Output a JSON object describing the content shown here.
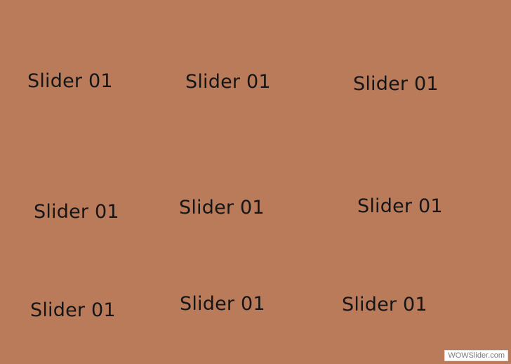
{
  "slider": {
    "background_color": "#b97b5a",
    "labels": [
      "Slider 01",
      "Slider 01",
      "Slider 01",
      "Slider 01",
      "Slider 01",
      "Slider 01",
      "Slider 01",
      "Slider 01",
      "Slider 01"
    ],
    "watermark": "WOWSlider.com"
  }
}
